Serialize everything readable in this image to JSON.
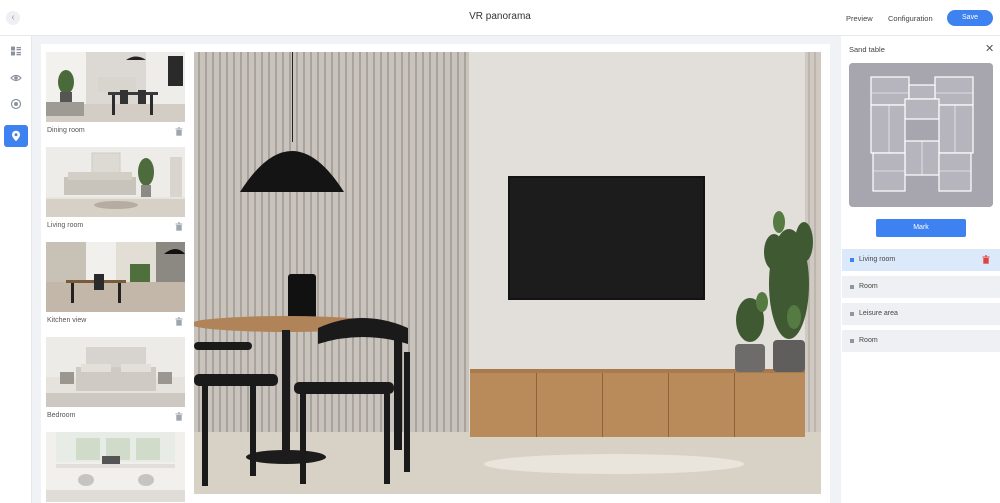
{
  "header": {
    "title": "VR panorama",
    "preview_label": "Preview",
    "configuration_label": "Configuration",
    "save_label": "Save"
  },
  "rail": {
    "items": [
      {
        "icon": "list-icon",
        "active": false
      },
      {
        "icon": "eye-icon",
        "active": false
      },
      {
        "icon": "target-icon",
        "active": false
      },
      {
        "icon": "location-pin-icon",
        "active": true
      }
    ]
  },
  "scenes": [
    {
      "label": "Dining room"
    },
    {
      "label": "Living room"
    },
    {
      "label": "Kitchen view"
    },
    {
      "label": "Bedroom"
    },
    {
      "label": ""
    }
  ],
  "sand_table": {
    "title": "Sand table",
    "mark_label": "Mark",
    "rooms": [
      {
        "label": "Living room",
        "active": true
      },
      {
        "label": "Room",
        "active": false
      },
      {
        "label": "Leisure area",
        "active": false
      },
      {
        "label": "Room",
        "active": false
      }
    ]
  },
  "colors": {
    "accent": "#3d82f0",
    "active_row": "#dce9fb",
    "delete": "#e0443e"
  }
}
